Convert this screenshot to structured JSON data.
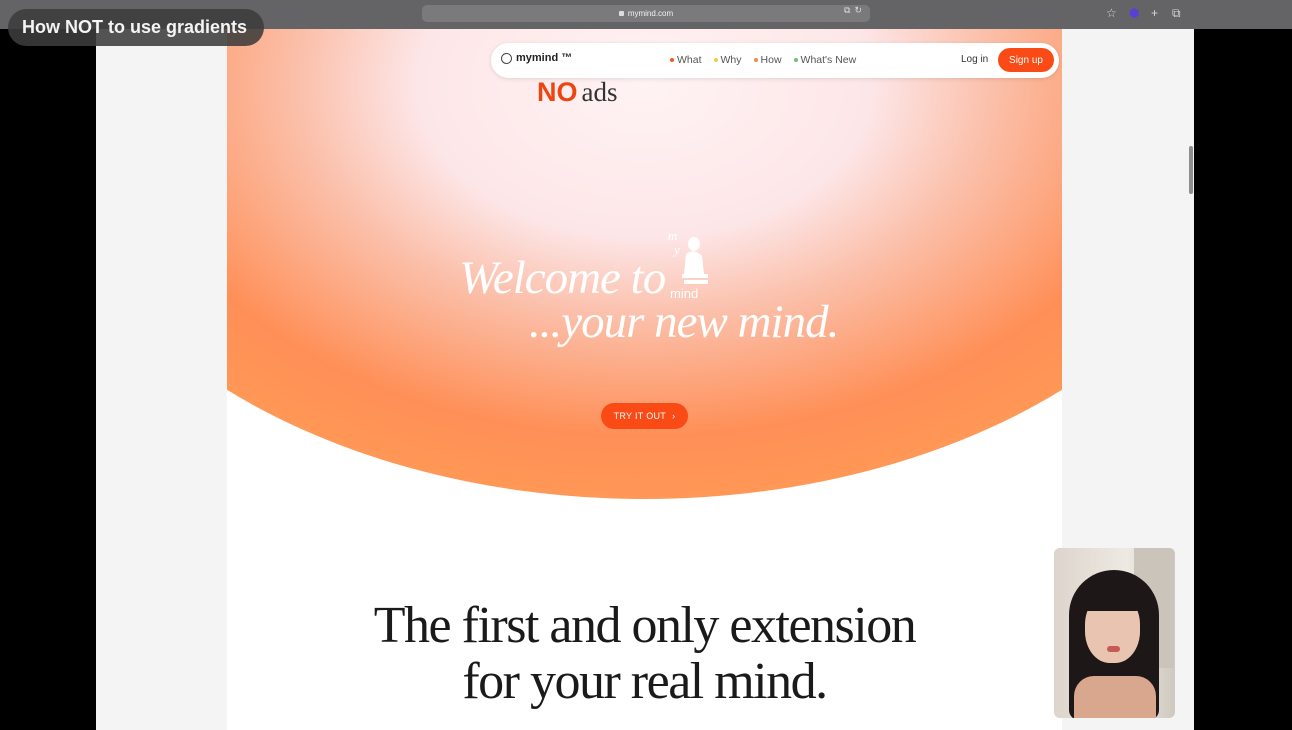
{
  "browser": {
    "url": "mymind.com",
    "toolbar_icons": [
      "translate-icon",
      "reload-icon",
      "star-icon",
      "extension-icon",
      "new-tab-icon",
      "tabs-icon"
    ]
  },
  "overlay": {
    "title": "How NOT to use gradients"
  },
  "site": {
    "logo_text": "mymind ™",
    "nav": [
      {
        "label": "What",
        "dot_color": "#f15a24"
      },
      {
        "label": "Why",
        "dot_color": "#f7c948"
      },
      {
        "label": "How",
        "dot_color": "#f08a4b"
      },
      {
        "label": "What's New",
        "dot_color": "#6fbf73"
      }
    ],
    "login_label": "Log in",
    "signup_label": "Sign up"
  },
  "hero": {
    "no_label": "NO",
    "ads_label": "ads",
    "welcome_line1": "Welcome to",
    "welcome_line2": "...your new mind.",
    "logo_mark_text": "my mind",
    "cta_label": "TRY IT OUT",
    "accent_color": "#fa4b17"
  },
  "section": {
    "heading_line1": "The first and only extension",
    "heading_line2": "for your real mind."
  }
}
